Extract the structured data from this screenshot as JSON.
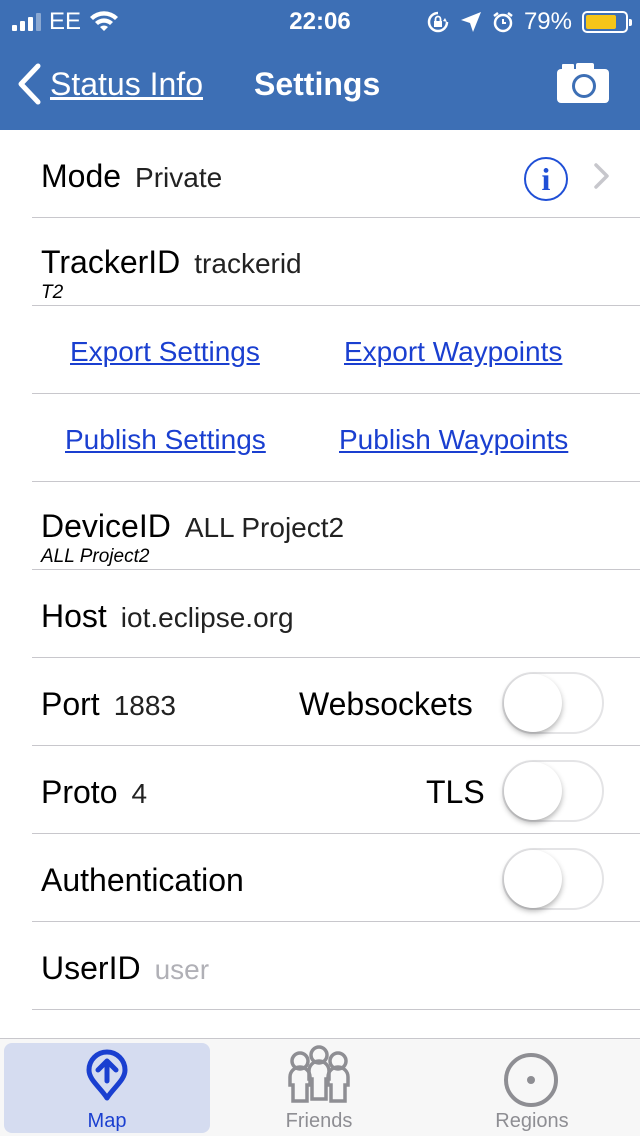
{
  "status_bar": {
    "carrier": "EE",
    "time": "22:06",
    "battery_percent": "79%",
    "battery_level": 0.79,
    "battery_color": "#f5c518"
  },
  "nav": {
    "back_label": "Status Info",
    "title": "Settings",
    "background": "#3d6fb5"
  },
  "settings": {
    "mode": {
      "label": "Mode",
      "value": "Private"
    },
    "tracker": {
      "label": "TrackerID",
      "value": "trackerid",
      "sub": "T2"
    },
    "export_settings": "Export Settings",
    "export_waypoints": "Export Waypoints",
    "publish_settings": "Publish Settings",
    "publish_waypoints": "Publish Waypoints",
    "device": {
      "label": "DeviceID",
      "value": "ALL Project2",
      "sub": "ALL Project2"
    },
    "host": {
      "label": "Host",
      "value": "iot.eclipse.org"
    },
    "port": {
      "label": "Port",
      "value": "1883",
      "toggle_label": "Websockets",
      "toggle_on": false
    },
    "proto": {
      "label": "Proto",
      "value": "4",
      "toggle_label": "TLS",
      "toggle_on": false
    },
    "authentication": {
      "label": "Authentication",
      "toggle_on": false
    },
    "user": {
      "label": "UserID",
      "placeholder": "user"
    }
  },
  "tabs": [
    {
      "label": "Map",
      "icon": "map-location-icon",
      "active": true
    },
    {
      "label": "Friends",
      "icon": "friends-icon",
      "active": false
    },
    {
      "label": "Regions",
      "icon": "regions-icon",
      "active": false
    }
  ],
  "colors": {
    "accent": "#1a3fd0",
    "link": "#1a3fd0",
    "active_tab_bg": "#d5dcf0"
  }
}
